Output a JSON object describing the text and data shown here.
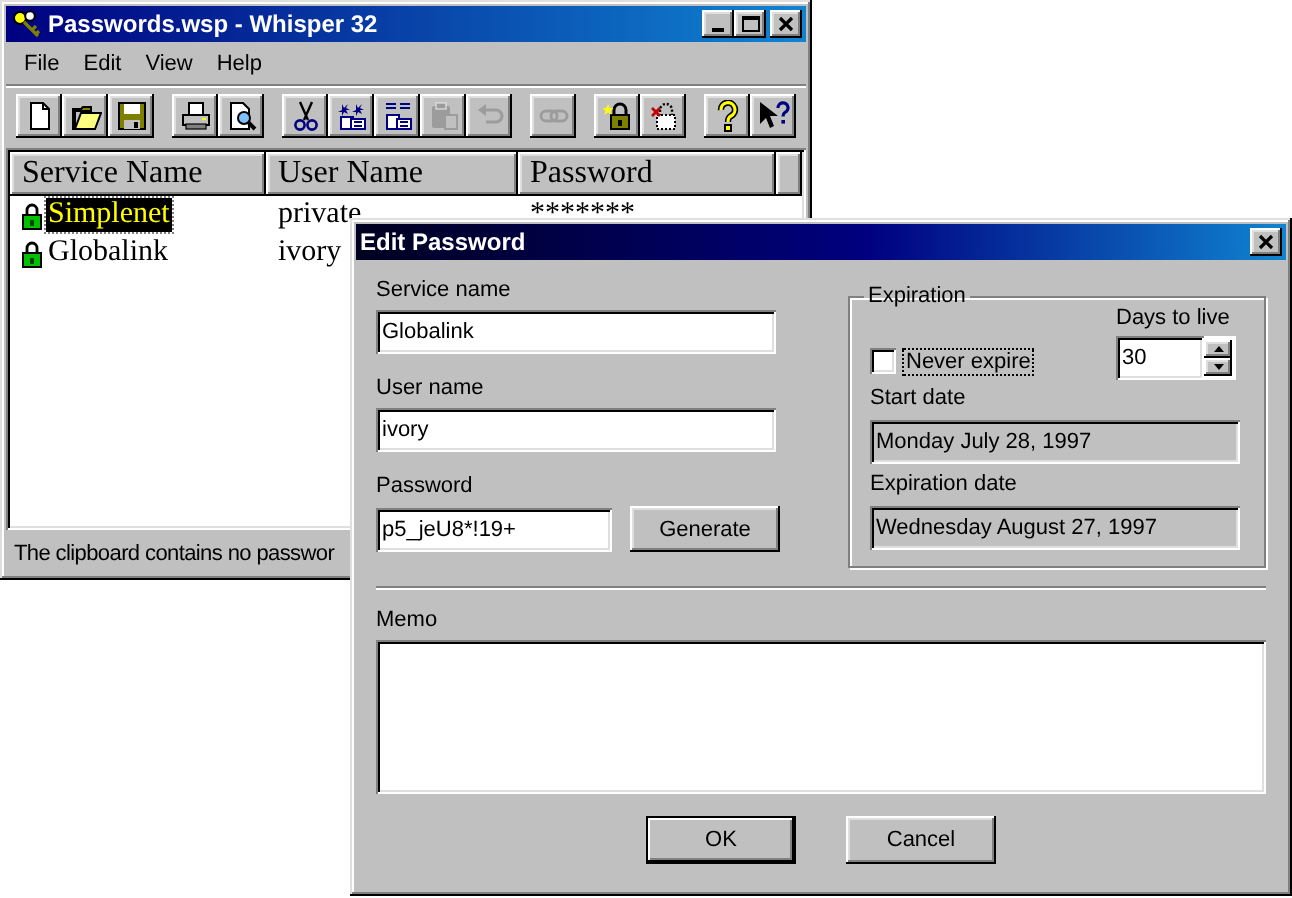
{
  "main_window": {
    "title": "Passwords.wsp - Whisper 32",
    "menu": [
      "File",
      "Edit",
      "View",
      "Help"
    ],
    "toolbar": [
      [
        {
          "kind": "new",
          "disabled": false
        },
        {
          "kind": "open",
          "disabled": false
        },
        {
          "kind": "save",
          "disabled": false
        }
      ],
      [
        {
          "kind": "print",
          "disabled": false
        },
        {
          "kind": "preview",
          "disabled": false
        }
      ],
      [
        {
          "kind": "cut",
          "disabled": false
        },
        {
          "kind": "copy-all",
          "disabled": false
        },
        {
          "kind": "copy",
          "disabled": false
        },
        {
          "kind": "paste",
          "disabled": true
        },
        {
          "kind": "undo",
          "disabled": true
        }
      ],
      [
        {
          "kind": "link",
          "disabled": true
        }
      ],
      [
        {
          "kind": "add-lock",
          "disabled": false
        },
        {
          "kind": "remove-lock",
          "disabled": false
        }
      ],
      [
        {
          "kind": "help",
          "disabled": false
        },
        {
          "kind": "context-help",
          "disabled": false
        }
      ]
    ],
    "table": {
      "columns": [
        "Service Name",
        "User Name",
        "Password"
      ],
      "rows": [
        {
          "service": "Simplenet",
          "user": "private",
          "password": "*******",
          "selected": true
        },
        {
          "service": "Globalink",
          "user": "ivory",
          "selected": false
        }
      ]
    },
    "status_bar": "The clipboard contains no passwor"
  },
  "dialog": {
    "title": "Edit Password",
    "service_name": {
      "label": "Service name",
      "value": "Globalink",
      "disabled": false
    },
    "user_name": {
      "label": "User name",
      "value": "ivory",
      "disabled": false
    },
    "password": {
      "label": "Password",
      "value": "p5_jeU8*!19+",
      "disabled": false
    },
    "generate_button": "Generate",
    "expiration": {
      "legend": "Expiration",
      "never_expire": {
        "label": "Never expire",
        "checked": false
      },
      "days_to_live": {
        "label": "Days to live",
        "value": "30"
      },
      "start_date": {
        "label": "Start date",
        "value": "Monday July 28, 1997",
        "disabled": true
      },
      "expiration_date": {
        "label": "Expiration date",
        "value": "Wednesday August 27, 1997",
        "disabled": true
      }
    },
    "memo": {
      "label": "Memo"
    },
    "buttons": [
      {
        "label": "OK",
        "default": true
      },
      {
        "label": "Cancel",
        "default": false
      }
    ]
  }
}
